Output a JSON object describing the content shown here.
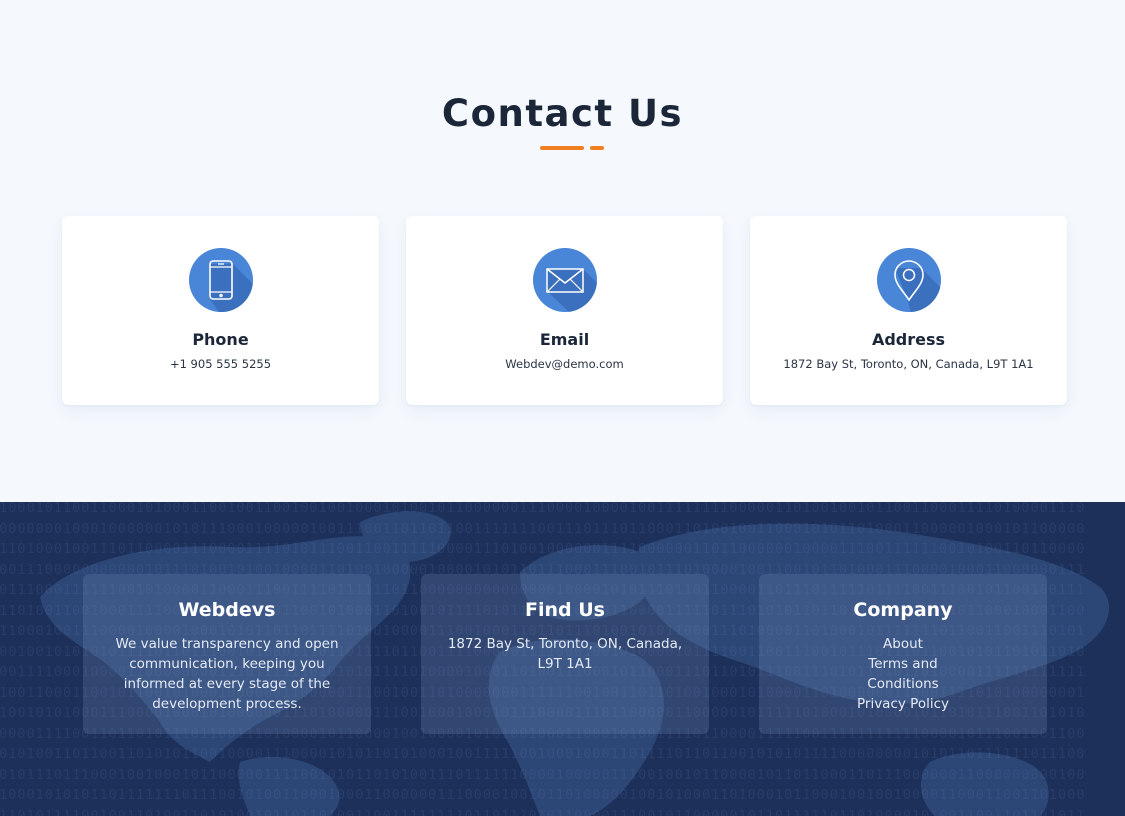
{
  "contact": {
    "title": "Contact Us",
    "cards": [
      {
        "icon": "phone-icon",
        "title": "Phone",
        "value": "+1 905 555 5255"
      },
      {
        "icon": "envelope-icon",
        "title": "Email",
        "value": "Webdev@demo.com"
      },
      {
        "icon": "map-pin-icon",
        "title": "Address",
        "value": "1872 Bay St, Toronto, ON, Canada, L9T 1A1"
      }
    ]
  },
  "footer": {
    "about": {
      "title": "Webdevs",
      "text": "We value transparency and open communication, keeping you informed at every stage of the development process."
    },
    "find_us": {
      "title": "Find Us",
      "text": "1872 Bay St, Toronto, ON, Canada, L9T 1A1"
    },
    "company": {
      "title": "Company",
      "links": [
        "About",
        "Terms and Conditions",
        "Privacy Policy"
      ]
    }
  },
  "colors": {
    "page_background": "#f5f9fe",
    "heading": "#1b2638",
    "accent": "#f07f1f",
    "icon_circle": "#4a86d8",
    "footer_background": "#1c305a"
  }
}
